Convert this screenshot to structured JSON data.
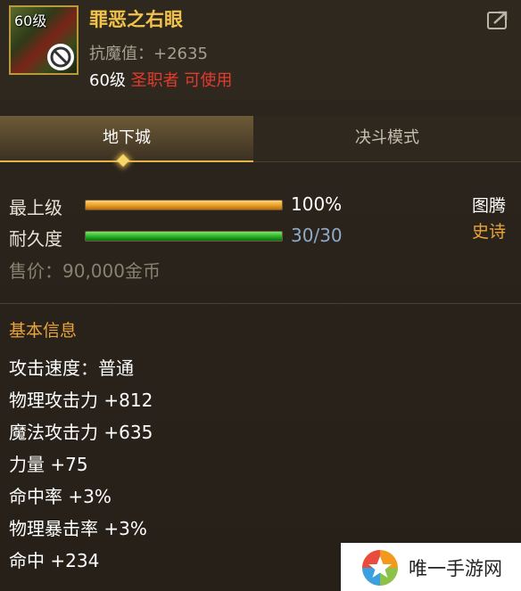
{
  "item": {
    "level_badge": "60级",
    "name": "罪恶之右眼",
    "stat": "抗魔值：+2635",
    "req_level": "60级",
    "req_class": "圣职者 可使用"
  },
  "tabs": [
    {
      "label": "地下城",
      "active": true
    },
    {
      "label": "决斗模式",
      "active": false
    }
  ],
  "bars": {
    "upgrade": {
      "label": "最上级",
      "value_text": "100%",
      "fraction": 1.0
    },
    "durability": {
      "label": "耐久度",
      "value_text": "30/30",
      "fraction": 1.0
    }
  },
  "side": {
    "type": "图腾",
    "rarity": "史诗"
  },
  "price": "售价：90,000金币",
  "basic_info": {
    "title": "基本信息",
    "attributes": [
      "攻击速度：普通",
      "物理攻击力 +812",
      "魔法攻击力 +635",
      "力量 +75",
      "命中率 +3%",
      "物理暴击率 +3%",
      "命中 +234"
    ]
  },
  "watermark": {
    "text": "唯一手游网"
  },
  "colors": {
    "rarity_epic": "#e9a43a",
    "item_name": "#f2c34a",
    "class_red": "#e53a2e"
  },
  "icons": {
    "ban": "ban-icon",
    "share": "share-icon",
    "logo": "star-logo-icon"
  }
}
